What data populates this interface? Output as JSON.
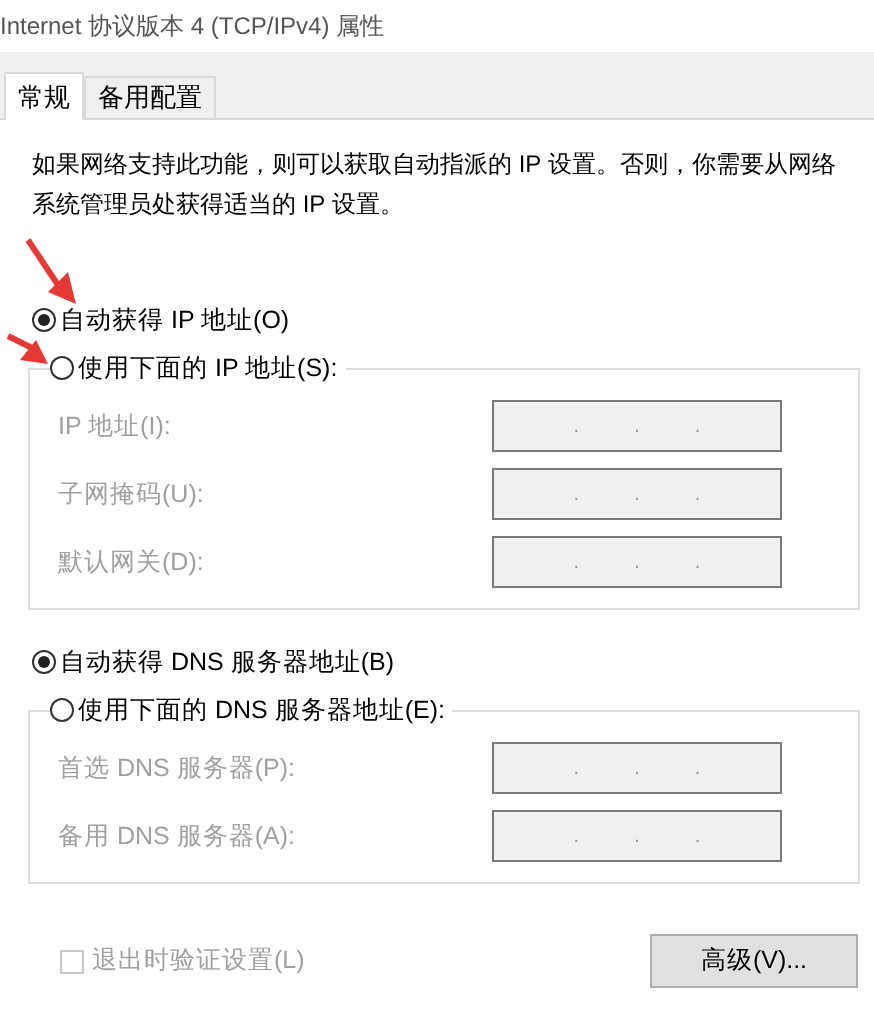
{
  "window": {
    "title": "Internet 协议版本 4 (TCP/IPv4) 属性"
  },
  "tabs": [
    {
      "label": "常规",
      "selected": true
    },
    {
      "label": "备用配置",
      "selected": false
    }
  ],
  "description": "如果网络支持此功能，则可以获取自动指派的 IP 设置。否则，你需要从网络系统管理员处获得适当的 IP 设置。",
  "ip_section": {
    "options": [
      {
        "label": "自动获得 IP 地址(O)",
        "selected": true
      },
      {
        "label": "使用下面的 IP 地址(S):",
        "selected": false
      }
    ],
    "fields": [
      {
        "label": "IP 地址(I):",
        "disabled": true,
        "separators": [
          ".",
          ".",
          "."
        ]
      },
      {
        "label": "子网掩码(U):",
        "disabled": true,
        "separators": [
          ".",
          ".",
          "."
        ]
      },
      {
        "label": "默认网关(D):",
        "disabled": true,
        "separators": [
          ".",
          ".",
          "."
        ]
      }
    ]
  },
  "dns_section": {
    "options": [
      {
        "label": "自动获得 DNS 服务器地址(B)",
        "selected": true
      },
      {
        "label": "使用下面的 DNS 服务器地址(E):",
        "selected": false
      }
    ],
    "fields": [
      {
        "label": "首选 DNS 服务器(P):",
        "disabled": true,
        "separators": [
          ".",
          ".",
          "."
        ]
      },
      {
        "label": "备用 DNS 服务器(A):",
        "disabled": true,
        "separators": [
          ".",
          ".",
          "."
        ]
      }
    ]
  },
  "validate_checkbox": {
    "label": "退出时验证设置(L)",
    "checked": false,
    "disabled": true
  },
  "advanced_button": "高级(V)...",
  "annotations": [
    {
      "kind": "arrow"
    },
    {
      "kind": "arrow"
    }
  ]
}
